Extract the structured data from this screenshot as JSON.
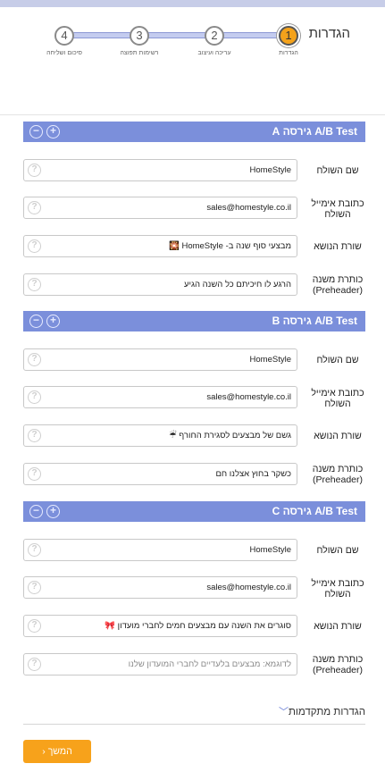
{
  "page": {
    "title": "הגדרות"
  },
  "stepper": {
    "steps": [
      {
        "number": "1",
        "label": "הגדרות",
        "active": true
      },
      {
        "number": "2",
        "label": "עריכה ועיצוב",
        "active": false
      },
      {
        "number": "3",
        "label": "רשימות תפוצה",
        "active": false
      },
      {
        "number": "4",
        "label": "סיכום ושליחה",
        "active": false
      }
    ]
  },
  "versions": [
    {
      "title": "A/B Test גירסה A",
      "fields": {
        "sender_name": {
          "label": "שם השולח",
          "value": "HomeStyle"
        },
        "sender_email": {
          "label": "כתובת אימייל השולח",
          "value": "sales@homestyle.co.il"
        },
        "subject": {
          "label": "שורת הנושא",
          "value": "מבצעי סוף שנה ב- HomeStyle 🎇"
        },
        "preheader": {
          "label": "כותרת משנה (Preheader)",
          "value": "הרגע לו חיכיתם כל השנה הגיע"
        }
      }
    },
    {
      "title": "A/B Test גירסה B",
      "fields": {
        "sender_name": {
          "label": "שם השולח",
          "value": "HomeStyle"
        },
        "sender_email": {
          "label": "כתובת אימייל השולח",
          "value": "sales@homestyle.co.il"
        },
        "subject": {
          "label": "שורת הנושא",
          "value": "גשם של מבצעים לסגירת החורף ☔"
        },
        "preheader": {
          "label": "כותרת משנה (Preheader)",
          "value": "כשקר בחוץ אצלנו חם"
        }
      }
    },
    {
      "title": "A/B Test גירסה C",
      "fields": {
        "sender_name": {
          "label": "שם השולח",
          "value": "HomeStyle"
        },
        "sender_email": {
          "label": "כתובת אימייל השולח",
          "value": "sales@homestyle.co.il"
        },
        "subject": {
          "label": "שורת הנושא",
          "value": "סוגרים את השנה עם מבצעים חמים לחברי מועדון 🎀"
        },
        "preheader": {
          "label": "כותרת משנה (Preheader)",
          "value": "",
          "placeholder": "לדוגמא: מבצעים בלעדיים לחברי המועדון שלנו"
        }
      }
    }
  ],
  "advanced": {
    "label": "הגדרות מתקדמות",
    "icon": "chevron-down-icon"
  },
  "footer": {
    "continue_label": "המשך",
    "continue_icon": "chevron-left-icon"
  },
  "colors": {
    "accent_orange": "#f7a21b",
    "header_blue": "#7b8fdb",
    "step_line": "#c4ccef"
  }
}
